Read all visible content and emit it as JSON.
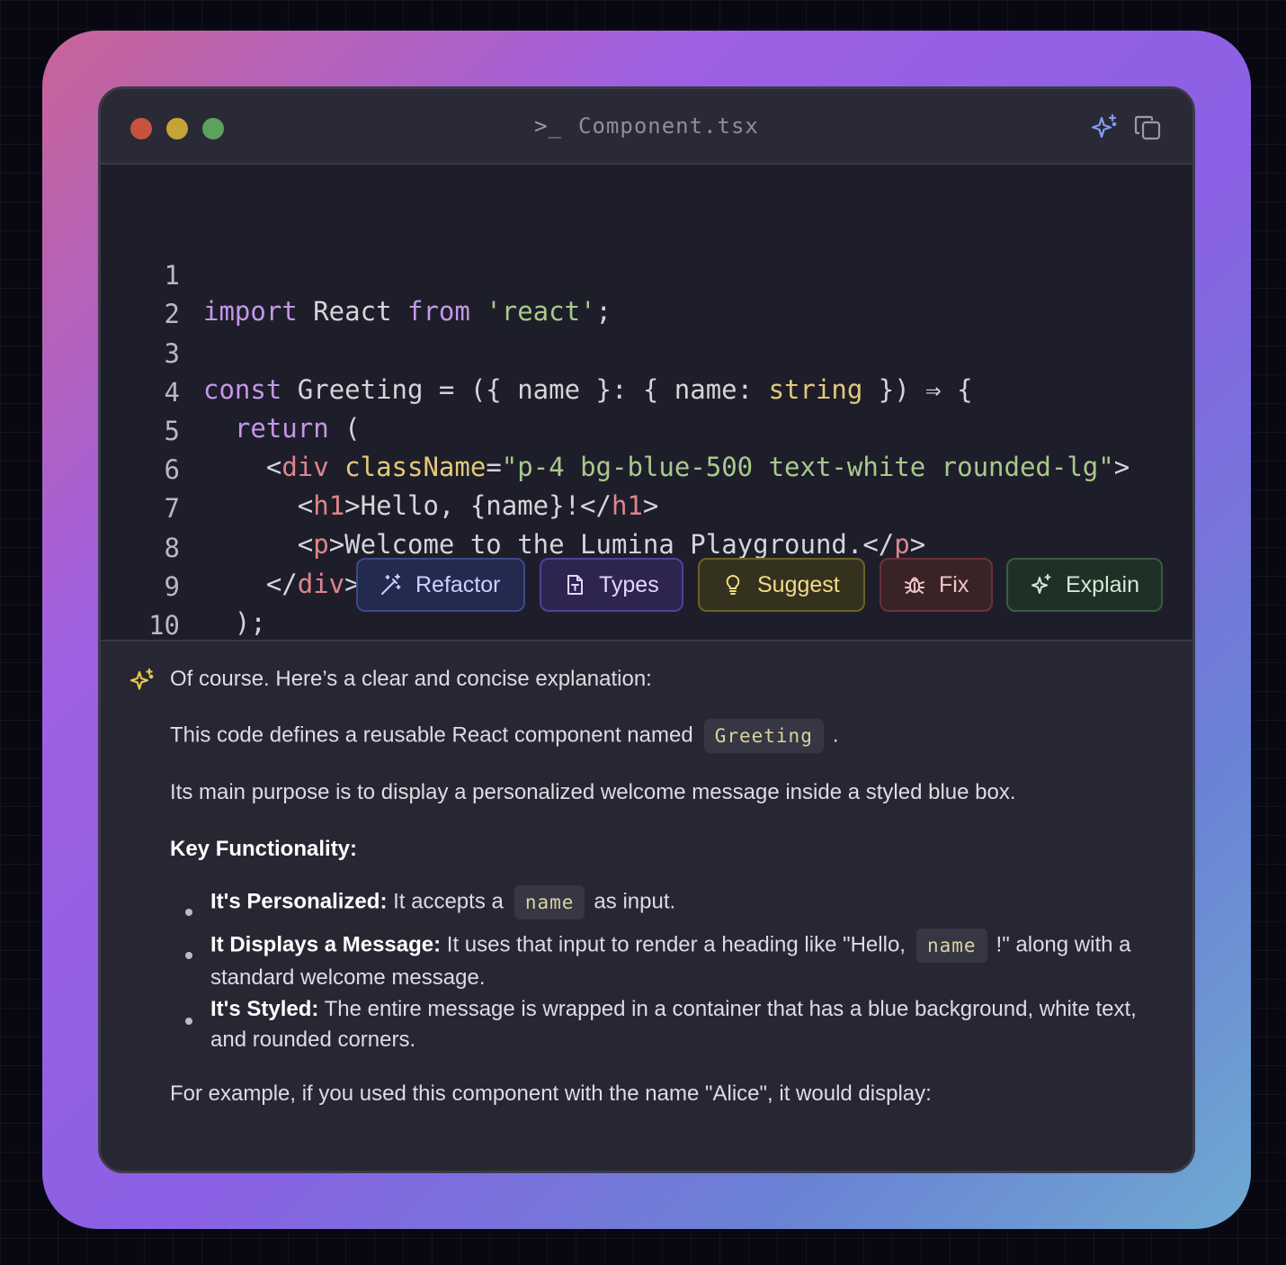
{
  "window": {
    "title": "Component.tsx",
    "title_icon": "terminal-prompt-icon",
    "prompt_glyph": ">_"
  },
  "code": {
    "line_numbers": [
      "1",
      "2",
      "3",
      "4",
      "5",
      "6",
      "7",
      "8",
      "9",
      "10"
    ],
    "tokens": {
      "l1_import": "import",
      "l1_react": " React ",
      "l1_from": "from",
      "l1_space": " ",
      "l1_str": "'react'",
      "l1_semi": ";",
      "l3_const": "const",
      "l3_a": " Greeting = ({ name }: { name: ",
      "l3_string": "string",
      "l3_b": " }) ⇒ {",
      "l4_indent": "  ",
      "l4_return": "return",
      "l4_paren": " (",
      "l5_indent": "    ",
      "l5_lt": "<",
      "l5_div": "div",
      "l5_sp": " ",
      "l5_attr": "className",
      "l5_eq": "=",
      "l5_val": "\"p-4 bg-blue-500 text-white rounded-lg\"",
      "l5_gt": ">",
      "l6_indent": "      ",
      "l6_lt": "<",
      "l6_h1": "h1",
      "l6_mid": ">Hello, {name}!</",
      "l6_h1b": "h1",
      "l6_gt": ">",
      "l7_indent": "      ",
      "l7_lt": "<",
      "l7_p": "p",
      "l7_mid": ">Welcome to the Lumina Playground.</",
      "l7_pb": "p",
      "l7_gt": ">",
      "l8_indent": "    ",
      "l8_lt": "</",
      "l8_div": "div",
      "l8_gt": ">",
      "l9": "  );",
      "l10": "};"
    }
  },
  "actions": [
    {
      "label": "Refactor",
      "icon": "magic-wand-icon",
      "color": "#3d4a8a"
    },
    {
      "label": "Types",
      "icon": "type-file-icon",
      "color": "#53409a"
    },
    {
      "label": "Suggest",
      "icon": "lightbulb-icon",
      "color": "#6c6125"
    },
    {
      "label": "Fix",
      "icon": "bug-icon",
      "color": "#6a3138"
    },
    {
      "label": "Explain",
      "icon": "sparkle-icon",
      "color": "#385d41"
    }
  ],
  "explanation": {
    "intro": "Of course. Here’s a clear and concise explanation:",
    "p1_text": "This code defines a reusable React component named",
    "p1_chip": "Greeting",
    "p1_end": ".",
    "p2": "Its main purpose is to display a personalized welcome message inside a styled blue box.",
    "heading": "Key Functionality:",
    "b1_bold": "It's Personalized:",
    "b1_text": " It accepts a",
    "b1_chip": "name",
    "b1_end": "as input.",
    "b2_bold": "It Displays a Message:",
    "b2_text": " It uses that input to render a heading like \"Hello,",
    "b2_chip": "name",
    "b2_end": "!\" along with a standard welcome message.",
    "b3_bold": "It's Styled:",
    "b3_text": " The entire message is wrapped in a container that has a blue background, white text, and rounded corners.",
    "p3": "For example, if you used this component with the name \"Alice\", it would display:"
  },
  "colors": {
    "keyword": "#c596e6",
    "string": "#a8c98c",
    "type": "#e2c979",
    "tag": "#e0848b",
    "accent_sparkle": "#7e9cf5",
    "explain_sparkle": "#e8c64a"
  }
}
